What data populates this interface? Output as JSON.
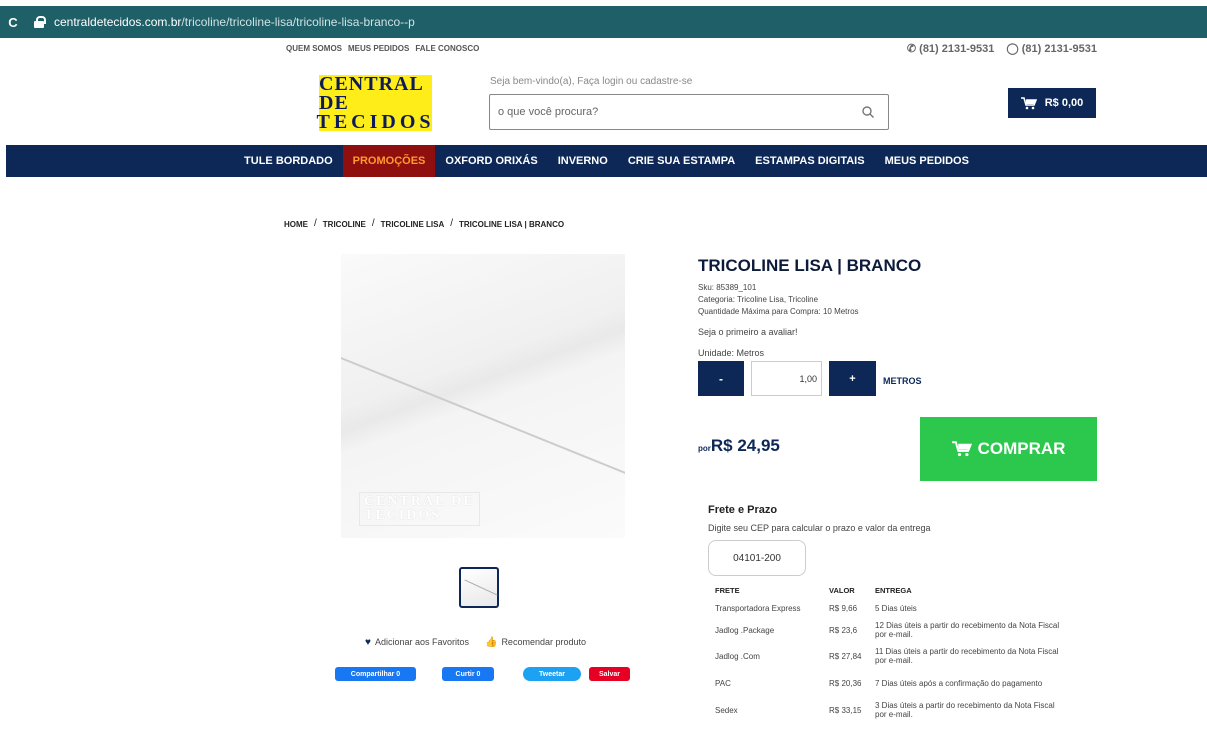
{
  "browser": {
    "url_domain": "centraldetecidos.com.br",
    "url_path": "/tricoline/tricoline-lisa/tricoline-lisa-branco--p"
  },
  "top_links": [
    "QUEM SOMOS",
    "MEUS PEDIDOS",
    "FALE CONOSCO"
  ],
  "phones": [
    "(81) 2131-9531",
    "(81) 2131-9531"
  ],
  "logo": {
    "line1": "CENTRAL DE",
    "line2": "TECIDOS"
  },
  "welcome": "Seja bem-vindo(a), Faça login ou cadastre-se",
  "search": {
    "placeholder": "o que você procura?"
  },
  "cart": {
    "label": "R$ 0,00"
  },
  "nav": [
    "TULE BORDADO",
    "PROMOÇÕES",
    "OXFORD ORIXÁS",
    "INVERNO",
    "CRIE SUA ESTAMPA",
    "ESTAMPAS DIGITAIS",
    "MEUS PEDIDOS"
  ],
  "breadcrumb": [
    "HOME",
    "TRICOLINE",
    "TRICOLINE LISA",
    "TRICOLINE LISA | BRANCO"
  ],
  "product": {
    "watermark_line1": "CENTRAL DE",
    "watermark_line2": "TECIDOS",
    "title": "TRICOLINE LISA | BRANCO",
    "sku": "Sku: 85389_101",
    "category": "Categoria: Tricoline Lisa,  Tricoline",
    "max_qty": "Quantidade Máxima para Compra: 10 Metros",
    "rating": "Seja o primeiro a avaliar!",
    "unit": "Unidade: Metros",
    "minus": "-",
    "qty": "1,00",
    "plus": "+",
    "unit_label": "METROS",
    "price_prefix": "por",
    "price": "R$ 24,95",
    "buy_label": "COMPRAR"
  },
  "actions": {
    "favorite": "Adicionar aos Favoritos",
    "recommend": "Recomendar produto"
  },
  "social": {
    "facebook_share": "Compartilhar 0",
    "facebook_like": "Curtir 0",
    "twitter": "Tweetar",
    "pinterest": "Salvar"
  },
  "shipping": {
    "title": "Frete e Prazo",
    "subtitle": "Digite seu CEP para calcular o prazo e valor da entrega",
    "cep": "04101-200",
    "headers": [
      "FRETE",
      "VALOR",
      "ENTREGA"
    ],
    "rows": [
      [
        "Transportadora Express",
        "R$ 9,66",
        "5 Dias úteis"
      ],
      [
        "Jadlog .Package",
        "R$ 23,6",
        "12 Dias úteis a partir do recebimento da Nota Fiscal por e-mail."
      ],
      [
        "Jadlog .Com",
        "R$ 27,84",
        "11 Dias úteis a partir do recebimento da Nota Fiscal por e-mail."
      ],
      [
        "PAC",
        "R$ 20,36",
        "7 Dias úteis após a confirmação do pagamento"
      ],
      [
        "Sedex",
        "R$ 33,15",
        "3 Dias úteis a partir do recebimento da Nota Fiscal por e-mail."
      ]
    ]
  }
}
